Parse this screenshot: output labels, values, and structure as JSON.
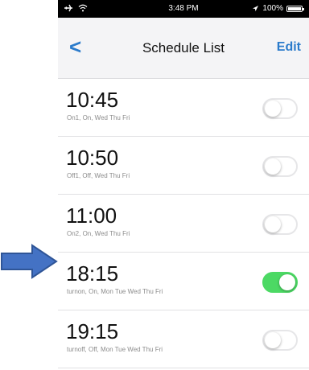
{
  "status_bar": {
    "time": "3:48 PM",
    "battery_text": "100%",
    "battery_level": 1.0,
    "icons": [
      "airplane-icon",
      "wifi-icon",
      "location-icon",
      "battery-icon"
    ]
  },
  "nav": {
    "back_label": "<",
    "title": "Schedule List",
    "edit_label": "Edit"
  },
  "schedules": [
    {
      "time": "10:45",
      "detail": "On1, On, Wed Thu Fri",
      "enabled": false
    },
    {
      "time": "10:50",
      "detail": "Off1, Off, Wed Thu Fri",
      "enabled": false
    },
    {
      "time": "11:00",
      "detail": "On2, On, Wed Thu Fri",
      "enabled": false
    },
    {
      "time": "18:15",
      "detail": "turnon, On, Mon Tue Wed Thu Fri",
      "enabled": true
    },
    {
      "time": "19:15",
      "detail": "turnoff, Off, Mon Tue Wed Thu Fri",
      "enabled": false
    }
  ],
  "colors": {
    "accent": "#2b7bcb",
    "toggle_on": "#4cd964",
    "annotation_arrow": "#4472c4"
  }
}
